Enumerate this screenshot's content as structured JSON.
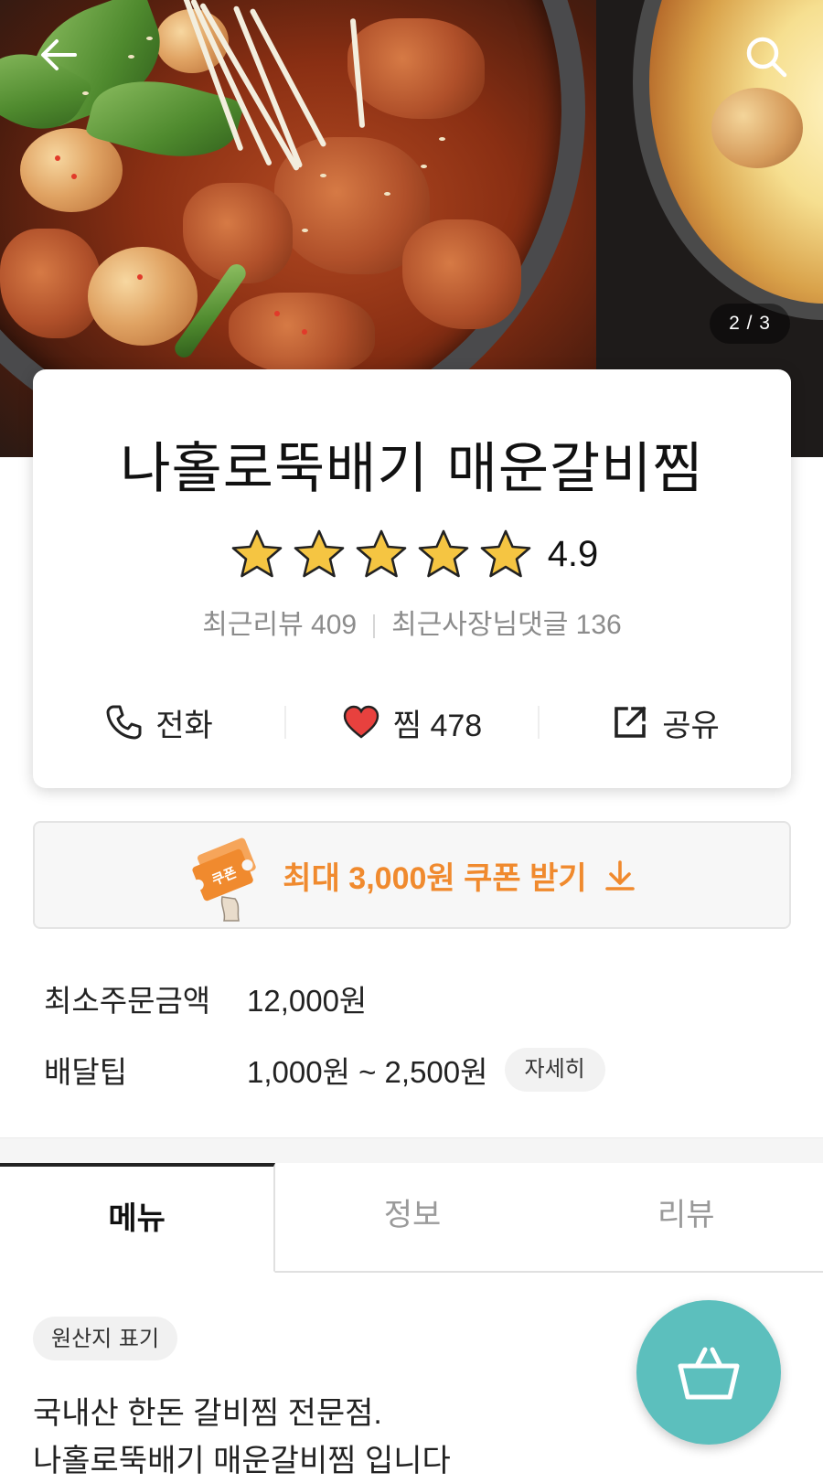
{
  "hero": {
    "pager": "2 / 3"
  },
  "store": {
    "name": "나홀로뚝배기 매운갈비찜",
    "rating": "4.9",
    "rating_value": 4.9,
    "rating_max": 5,
    "recent_reviews_label": "최근리뷰 409",
    "owner_comments_label": "최근사장님댓글 136"
  },
  "actions": {
    "call_label": "전화",
    "like_label": "찜 478",
    "share_label": "공유"
  },
  "coupon": {
    "badge": "쿠폰",
    "label": "최대 3,000원 쿠폰 받기"
  },
  "delivery": {
    "min_order_label": "최소주문금액",
    "min_order_value": "12,000원",
    "tip_label": "배달팁",
    "tip_value": "1,000원 ~ 2,500원",
    "detail_button": "자세히"
  },
  "tabs": [
    {
      "label": "메뉴",
      "active": true
    },
    {
      "label": "정보",
      "active": false
    },
    {
      "label": "리뷰",
      "active": false
    }
  ],
  "menu": {
    "origin_chip": "원산지 표기",
    "description_line1": "국내산 한돈 갈비찜 전문점.",
    "description_line2": "나홀로뚝배기 매운갈비찜 입니다"
  },
  "colors": {
    "accent_orange": "#f08a2e",
    "cart_teal": "#5cbfbd",
    "star_gold": "#f5c542",
    "heart_red": "#e8413e"
  },
  "icons": {
    "back": "arrow-left-icon",
    "search": "search-icon",
    "star": "star-icon",
    "phone": "phone-icon",
    "heart": "heart-icon",
    "share": "share-icon",
    "coupon": "coupon-icon",
    "download": "download-arrow-icon",
    "cart": "basket-icon"
  }
}
